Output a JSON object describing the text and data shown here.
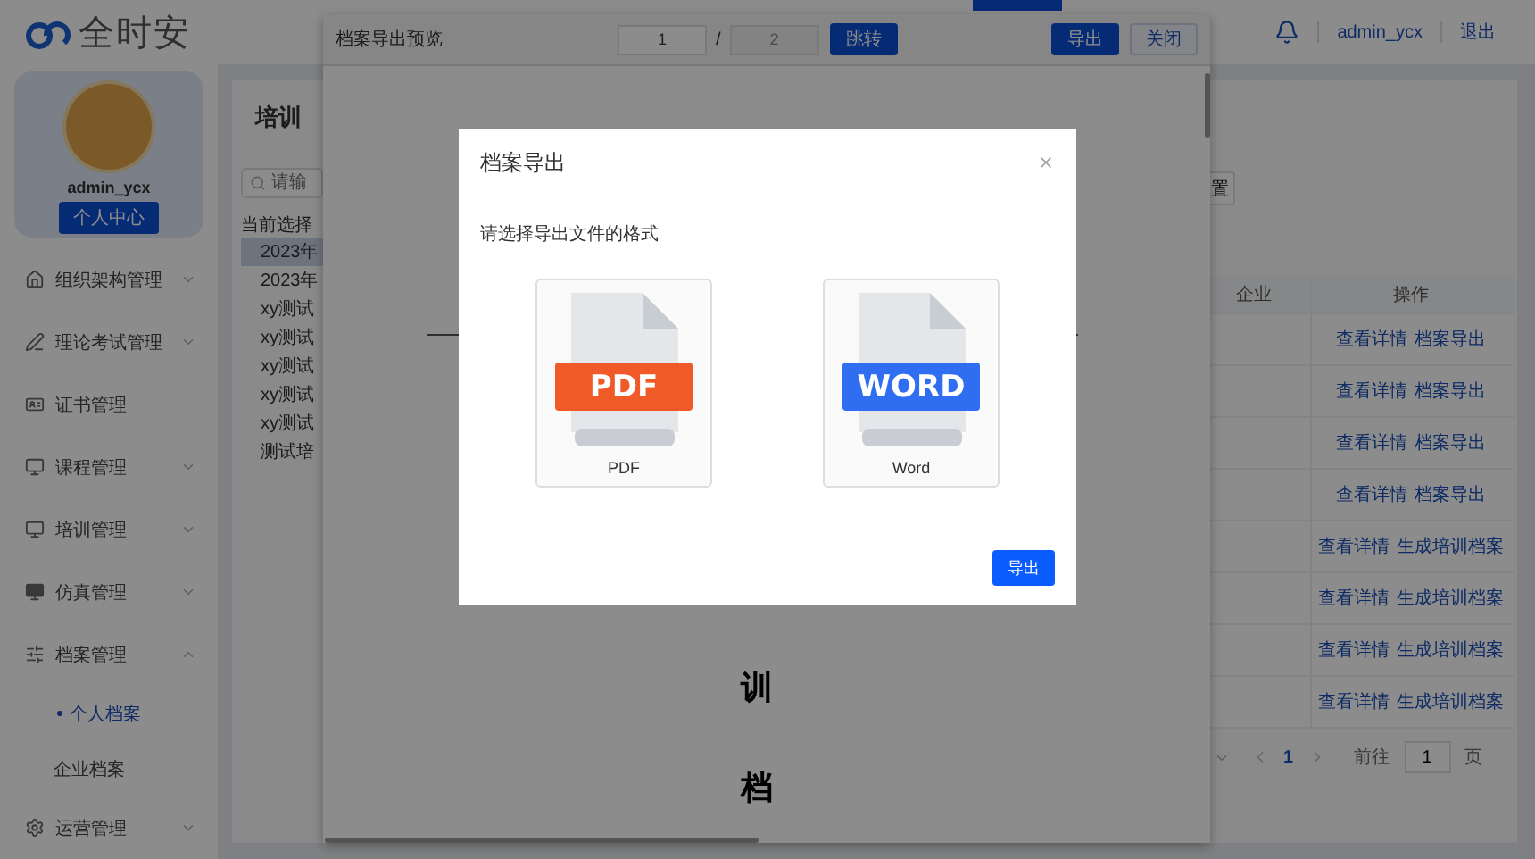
{
  "header": {
    "logo": "全时安",
    "user": "admin_ycx",
    "logout": "退出"
  },
  "sidebar": {
    "profile": {
      "name": "admin_ycx",
      "button": "个人中心"
    },
    "menu": [
      {
        "kind": "group",
        "label": "组织架构管理",
        "expanded": false
      },
      {
        "kind": "group",
        "label": "理论考试管理",
        "expanded": false
      },
      {
        "kind": "link",
        "label": "证书管理"
      },
      {
        "kind": "group",
        "label": "课程管理",
        "expanded": false
      },
      {
        "kind": "group",
        "label": "培训管理",
        "expanded": false
      },
      {
        "kind": "group",
        "label": "仿真管理",
        "expanded": false
      },
      {
        "kind": "group",
        "label": "档案管理",
        "expanded": true,
        "children": [
          {
            "label": "个人档案",
            "selected": true
          },
          {
            "label": "企业档案",
            "selected": false
          }
        ]
      },
      {
        "kind": "group",
        "label": "运营管理",
        "expanded": false
      }
    ]
  },
  "main": {
    "title": "培训",
    "search": {
      "placeholder": "请输"
    },
    "category_label": "当前选择",
    "tree": [
      {
        "label": "2023年",
        "selected": true
      },
      {
        "label": "2023年",
        "selected": false
      },
      {
        "label": "xy测试",
        "selected": false
      },
      {
        "label": "xy测试",
        "selected": false
      },
      {
        "label": "xy测试",
        "selected": false
      },
      {
        "label": "xy测试",
        "selected": false
      },
      {
        "label": "xy测试",
        "selected": false
      },
      {
        "label": "测试培",
        "selected": false
      }
    ],
    "reset_button": "置",
    "table": {
      "columns": [
        "企业",
        "操作"
      ],
      "rows": [
        {
          "actions": [
            "查看详情",
            "档案导出"
          ]
        },
        {
          "actions": [
            "查看详情",
            "档案导出"
          ]
        },
        {
          "actions": [
            "查看详情",
            "档案导出"
          ]
        },
        {
          "actions": [
            "查看详情",
            "档案导出"
          ]
        },
        {
          "actions": [
            "查看详情",
            "生成培训档案"
          ]
        },
        {
          "actions": [
            "查看详情",
            "生成培训档案"
          ]
        },
        {
          "actions": [
            "查看详情",
            "生成培训档案"
          ]
        },
        {
          "actions": [
            "查看详情",
            "生成培训档案"
          ]
        }
      ]
    },
    "pagination": {
      "pages": [
        {
          "label": "1",
          "selected": true
        }
      ],
      "goto_label": "前往",
      "goto_value": "1",
      "page_unit": "页"
    }
  },
  "preview": {
    "title": "档案导出预览",
    "page_input": "1",
    "separator": "/",
    "total_input": "2",
    "jump_button": "跳转",
    "export_button": "导出",
    "close_button": "关闭",
    "body_text": "训档"
  },
  "dialog": {
    "title": "档案导出",
    "prompt": "请选择导出文件的格式",
    "formats": [
      {
        "badge": "PDF",
        "label": "PDF",
        "color": "#f05a28",
        "selected": false
      },
      {
        "badge": "WORD",
        "label": "Word",
        "color": "#2f6ef0",
        "selected": false
      }
    ],
    "confirm": "导出"
  }
}
